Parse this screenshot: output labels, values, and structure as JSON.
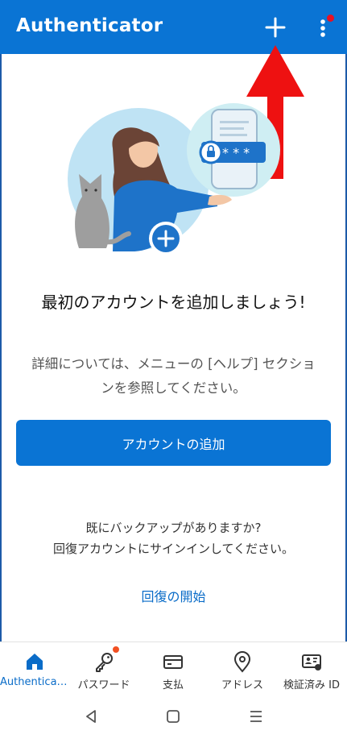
{
  "app_bar": {
    "title": "Authenticator",
    "add_icon": "plus-icon",
    "more_icon": "more-vertical-icon",
    "notification_color": "#e81123"
  },
  "colors": {
    "brand": "#0a74d4",
    "link": "#0a6cc8",
    "annotation_arrow": "#ee1111"
  },
  "main": {
    "headline": "最初のアカウントを追加しましょう!",
    "subtext": "詳細については、メニューの [ヘルプ] セクションを参照してください。",
    "add_account_button": "アカウントの追加",
    "backup_line1": "既にバックアップがありますか?",
    "backup_line2": "回復アカウントにサインインしてください。",
    "recovery_link": "回復の開始"
  },
  "bottom_nav": {
    "items": [
      {
        "label": "Authenticator",
        "icon": "home-icon",
        "active": true
      },
      {
        "label": "パスワード",
        "icon": "key-icon",
        "badge": true
      },
      {
        "label": "支払",
        "icon": "credit-card-icon"
      },
      {
        "label": "アドレス",
        "icon": "location-pin-icon"
      },
      {
        "label": "検証済み ID",
        "icon": "verified-id-icon"
      }
    ]
  },
  "system_nav": {
    "back": "back-icon",
    "home": "home-circle-icon",
    "recents": "recents-icon"
  }
}
